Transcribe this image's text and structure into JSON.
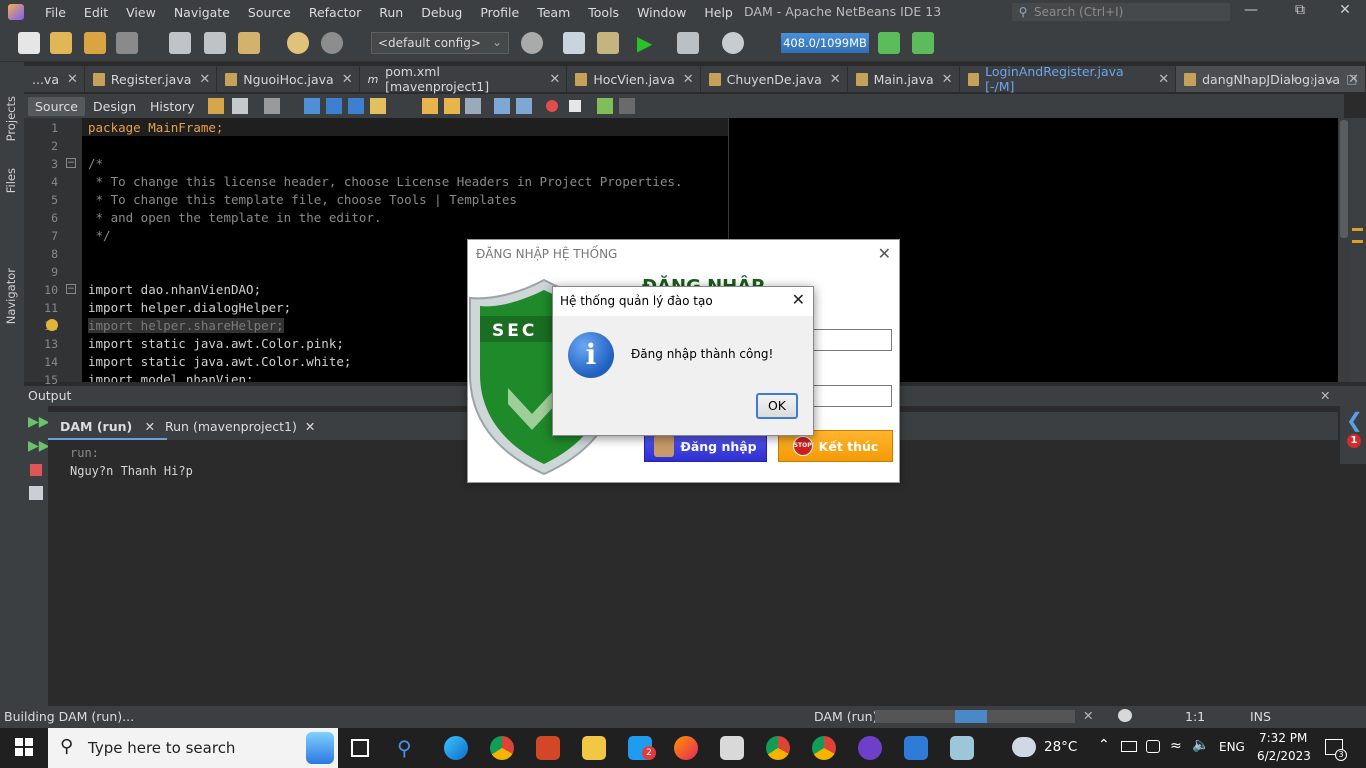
{
  "menubar": {
    "items": [
      "File",
      "Edit",
      "View",
      "Navigate",
      "Source",
      "Refactor",
      "Run",
      "Debug",
      "Profile",
      "Team",
      "Tools",
      "Window",
      "Help"
    ],
    "title": "DAM - Apache NetBeans IDE 13",
    "search_placeholder": "Search (Ctrl+I)"
  },
  "toolbar": {
    "config": "<default config>",
    "memory": "408.0/1099MB"
  },
  "sidebar": {
    "projects": "Projects",
    "files": "Files",
    "navigator": "Navigator"
  },
  "file_tabs": [
    {
      "label": "...va"
    },
    {
      "label": "Register.java"
    },
    {
      "label": "NguoiHoc.java"
    },
    {
      "label": "pom.xml [mavenproject1]"
    },
    {
      "label": "HocVien.java"
    },
    {
      "label": "ChuyenDe.java"
    },
    {
      "label": "Main.java"
    },
    {
      "label": "LoginAndRegister.java [-/M]"
    },
    {
      "label": "dangNhapJDialog.java"
    }
  ],
  "editor_views": [
    "Source",
    "Design",
    "History"
  ],
  "code": {
    "line_numbers": [
      "1",
      "2",
      "3",
      "4",
      "5",
      "6",
      "7",
      "8",
      "9",
      "10",
      "11",
      "12",
      "13",
      "14",
      "15"
    ],
    "lines": [
      "package MainFrame;",
      "",
      "/*",
      " * To change this license header, choose License Headers in Project Properties.",
      " * To change this template file, choose Tools | Templates",
      " * and open the template in the editor.",
      " */",
      "",
      "",
      "import dao.nhanVienDAO;",
      "import helper.dialogHelper;",
      "import helper.shareHelper;",
      "import static java.awt.Color.pink;",
      "import static java.awt.Color.white;",
      "import model.nhanVien;"
    ]
  },
  "output": {
    "title": "Output",
    "tabs": [
      "DAM (run)",
      "Run (mavenproject1)"
    ],
    "lines": [
      "run:",
      "Nguy?n Thanh Hi?p"
    ]
  },
  "statusbar": {
    "left": "Building DAM (run)...",
    "task": "DAM (run)",
    "progress": 0.5,
    "position": "1:1",
    "mode": "INS"
  },
  "login_dialog": {
    "title": "ĐĂNG NHẬP HỆ THỐNG",
    "heading": "ĐĂNG NHẬP",
    "shield_text": "SEC",
    "login_button": "Đăng nhập",
    "exit_button": "Kết thúc",
    "stop_label": "STOP"
  },
  "message_dialog": {
    "title": "Hệ thống quản lý đào tạo",
    "message": "Đăng nhập thành công!",
    "ok": "OK",
    "icon": "i"
  },
  "notification": {
    "count": "1"
  },
  "taskbar": {
    "search_placeholder": "Type here to search",
    "weather": "28°C",
    "language": "ENG",
    "time": "7:32 PM",
    "date": "6/2/2023",
    "notifications": "3",
    "zalo_badge": "2"
  },
  "colors": {
    "ide_bg": "#2b2b2b",
    "panel": "#3c3f41",
    "keyword": "#e8a04a",
    "link_tab": "#6ca4ee",
    "login_button": "#3b3de0",
    "exit_button": "#f5a30d"
  }
}
